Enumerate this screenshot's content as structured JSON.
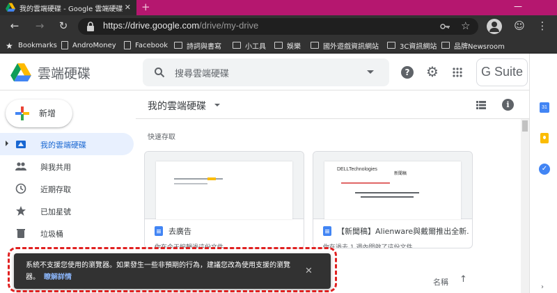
{
  "browser": {
    "tab_title": "我的雲端硬碟 - Google 雲端硬碟",
    "tab_close": "✕",
    "new_tab": "+",
    "window_min": "—",
    "url_host": "https://drive.google.com",
    "url_path": "/drive/my-drive",
    "tab_color": "#b5176f"
  },
  "bookmarks": [
    {
      "label": "Bookmarks",
      "icon": "star-icon"
    },
    {
      "label": "AndroMoney",
      "icon": "page-icon"
    },
    {
      "label": "Facebook",
      "icon": "page-icon"
    },
    {
      "label": "詩詞與書寫",
      "icon": "folder-icon"
    },
    {
      "label": "小工具",
      "icon": "folder-icon"
    },
    {
      "label": "娛樂",
      "icon": "folder-icon"
    },
    {
      "label": "國外遊戲資訊網站",
      "icon": "folder-icon"
    },
    {
      "label": "3C資訊網站",
      "icon": "folder-icon"
    },
    {
      "label": "品牌Newsroom",
      "icon": "folder-icon"
    }
  ],
  "header": {
    "product_name": "雲端硬碟",
    "search_placeholder": "搜尋雲端硬碟",
    "gsuite_label": "G Suite"
  },
  "sidebar": {
    "new_label": "新增",
    "items": [
      {
        "label": "我的雲端硬碟",
        "icon": "drive-icon",
        "active": true
      },
      {
        "label": "與我共用",
        "icon": "people-icon",
        "active": false
      },
      {
        "label": "近期存取",
        "icon": "clock-icon",
        "active": false
      },
      {
        "label": "已加星號",
        "icon": "star-icon",
        "active": false
      },
      {
        "label": "垃圾桶",
        "icon": "trash-icon",
        "active": false
      }
    ]
  },
  "main": {
    "title": "我的雲端硬碟",
    "quick_access_label": "快速存取",
    "cards": [
      {
        "name": "去廣告",
        "meta": "你在今天編輯過這份文件"
      },
      {
        "name": "【新聞稿】Alienware與戴爾推出全新...",
        "meta": "你在過去 1 週內開啟了這份文件",
        "preview_brand": "DELLTechnologies",
        "preview_heading": "新聞稿"
      }
    ],
    "sort_label": "名稱",
    "sort_arrow": "↑"
  },
  "toast": {
    "message": "系統不支援您使用的瀏覽器。如果發生一些非預期的行為，建議您改為使用支援的瀏覽器。",
    "link": "瞭解詳情",
    "close": "✕"
  }
}
